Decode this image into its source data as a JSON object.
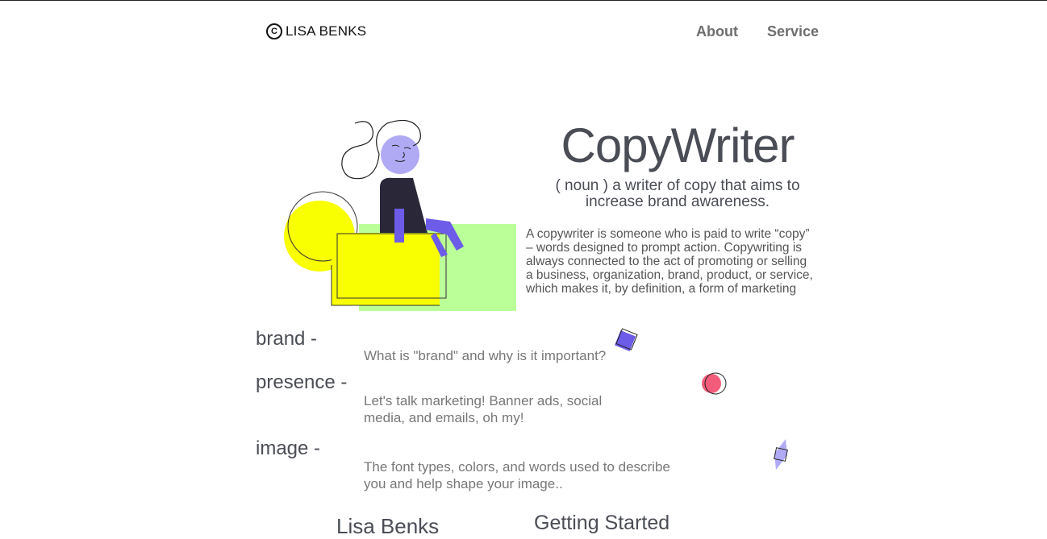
{
  "header": {
    "logo_text": "LISA BENKS",
    "nav": [
      {
        "label": "About"
      },
      {
        "label": "Service"
      }
    ]
  },
  "hero": {
    "title": "CopyWriter",
    "subtitle": "( noun ) a writer of copy that aims to increase brand awareness.",
    "description": "A copywriter is someone who is paid to write “copy” – words designed to prompt action. Copywriting is always connected to the act of promoting or selling a business, organization, brand, product, or service, which makes it, by definition, a form of marketing"
  },
  "topics": [
    {
      "title": "brand -",
      "text": "What is \"brand\" and why is it important?"
    },
    {
      "title": "presence -",
      "text": "Let's talk marketing! Banner ads, social media, and emails, oh my!"
    },
    {
      "title": "image -",
      "text": "The font types, colors, and words used to describe you and help shape your image.."
    }
  ],
  "footer": {
    "left_heading": "Lisa Benks",
    "right_heading": "Getting Started"
  },
  "colors": {
    "yellow": "#f9ff00",
    "green": "#bbff99",
    "purple": "#6c5ce7",
    "lavender": "#b0aaf5",
    "pink": "#f25c7a",
    "dark": "#2a2838"
  }
}
